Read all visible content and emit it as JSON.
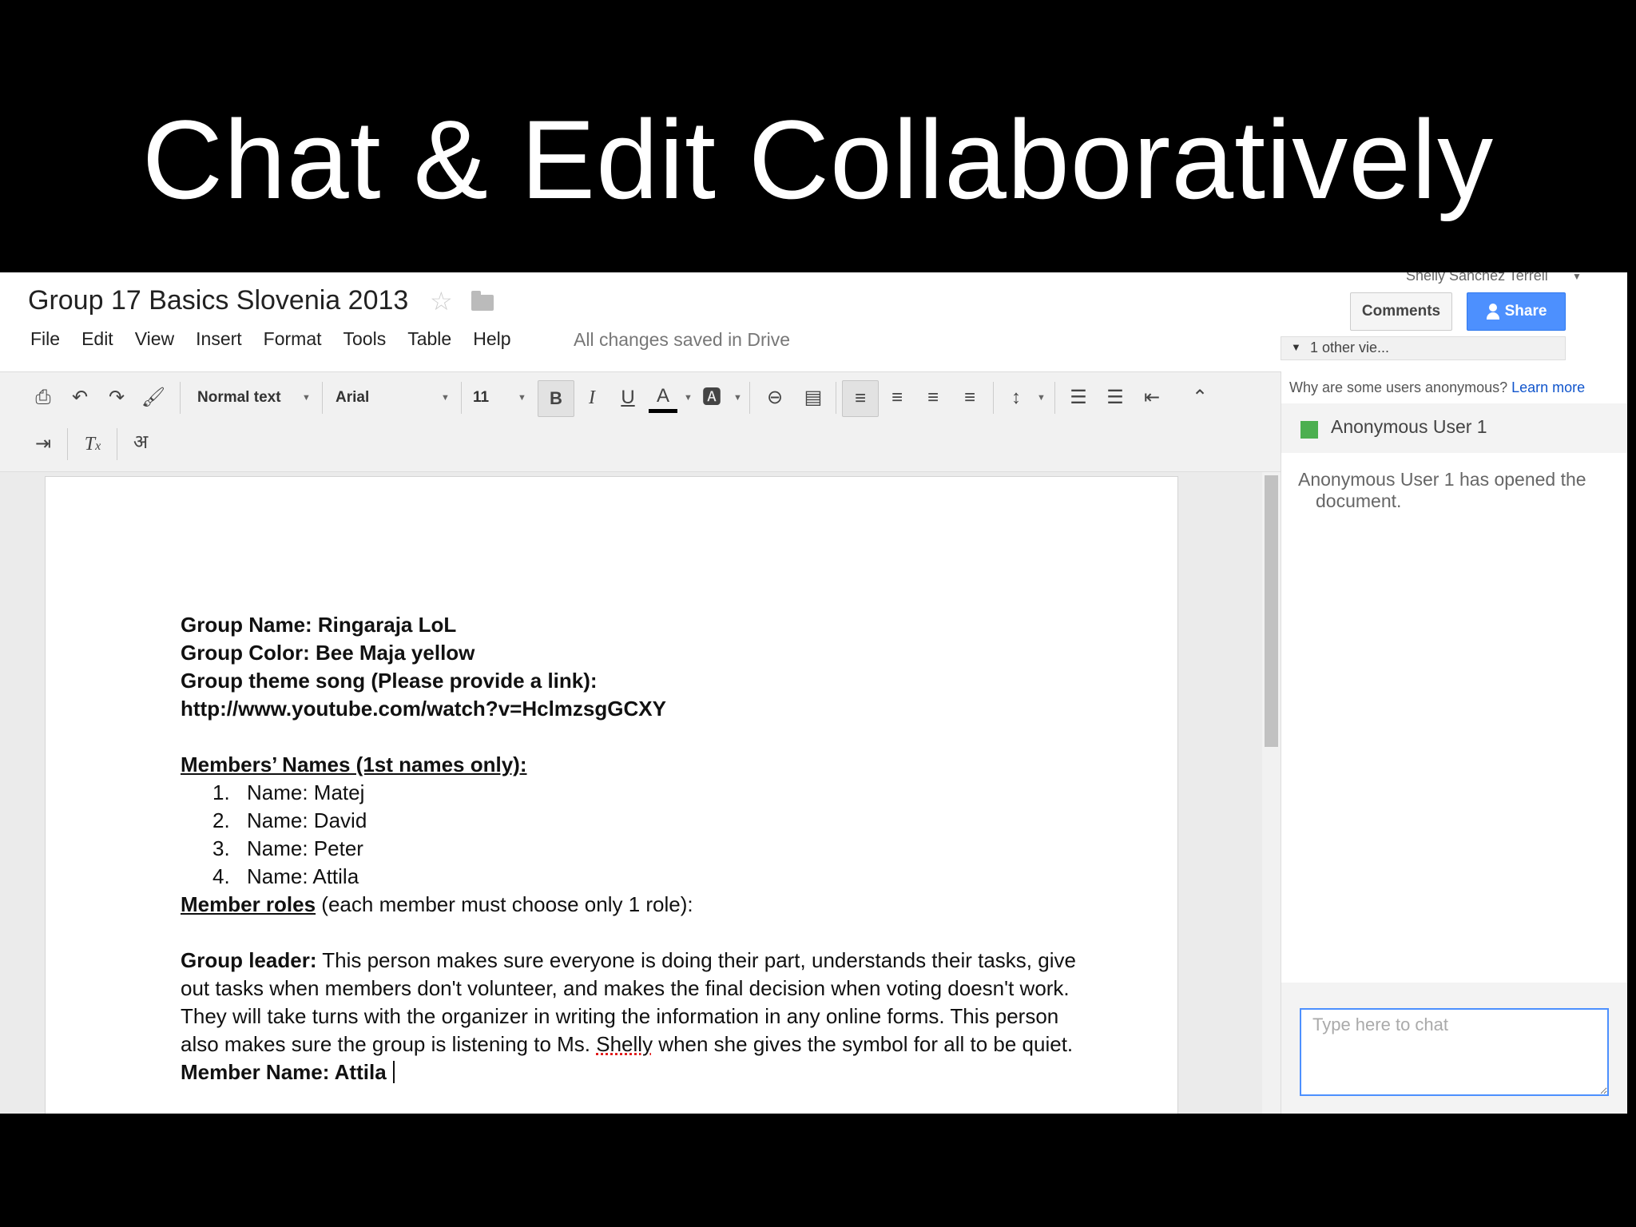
{
  "slide": {
    "title": "Chat & Edit Collaboratively"
  },
  "header": {
    "doc_title": "Group 17 Basics Slovenia 2013",
    "user_name": "Shelly Sanchez Terrell",
    "comments_label": "Comments",
    "share_label": "Share",
    "save_status": "All changes saved in Drive",
    "viewers_label": "1 other vie..."
  },
  "menu": [
    "File",
    "Edit",
    "View",
    "Insert",
    "Format",
    "Tools",
    "Table",
    "Help"
  ],
  "toolbar": {
    "style": "Normal text",
    "font": "Arial",
    "size": "11",
    "bold": "B",
    "italic": "I",
    "underline": "U",
    "text_color": "A",
    "input_tools": "अ"
  },
  "document": {
    "group_name": "Group Name: Ringaraja LoL",
    "group_color": "Group Color: Bee Maja yellow",
    "theme_song": "Group theme song (Please provide a link):",
    "link": "http://www.youtube.com/watch?v=HclmzsgGCXY",
    "members_heading": "Members’ Names (1st names only):",
    "members": [
      {
        "num": "1.",
        "text": "Name: Matej"
      },
      {
        "num": "2.",
        "text": "Name: David"
      },
      {
        "num": "3.",
        "text": "Name: Peter"
      },
      {
        "num": "4.",
        "text": "Name: Attila"
      }
    ],
    "roles_heading": "Member roles",
    "roles_note": " (each member must choose only 1 role):",
    "leader_label": "Group leader:",
    "leader_text_1": " This person makes sure everyone is doing their part, understands their tasks, give out tasks when members don't volunteer, and makes the final decision when voting doesn't work.  They will take turns with the organizer in writing the information in any online forms. This person also makes sure the group is listening to Ms. ",
    "leader_text_name": "Shelly",
    "leader_text_2": " when she gives the symbol for all to be quiet.",
    "member_name_line": "Member Name: Attila"
  },
  "chat": {
    "anon_question": "Why are some users anonymous?",
    "learn_more": "Learn more",
    "user": "Anonymous User 1",
    "message_line1": "Anonymous User 1 has opened the",
    "message_line2": "document.",
    "input_placeholder": "Type here to chat",
    "user_color": "#4caf50"
  }
}
